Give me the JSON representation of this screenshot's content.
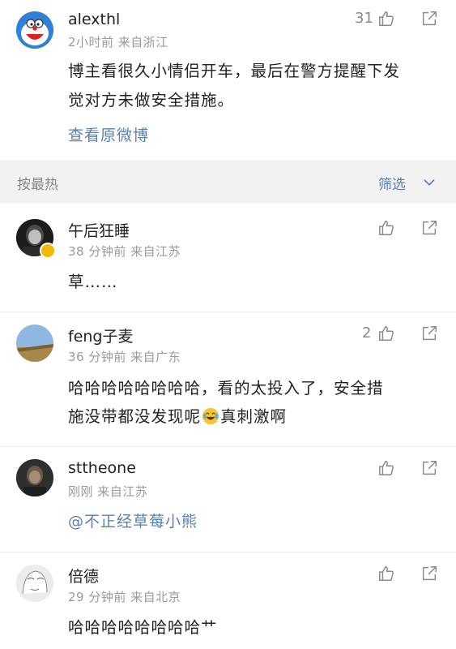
{
  "post": {
    "author": "alexthl",
    "meta": "2小时前   来自浙江",
    "like_count": "31",
    "text_line1": "博主看很久小情侣开车，最后在警方提醒下发",
    "text_line2": "觉对方未做安全措施。",
    "view_original": "查看原微博"
  },
  "sort_bar": {
    "sort_label": "按最热",
    "filter_label": "筛选"
  },
  "comments": [
    {
      "author": "午后狂睡",
      "meta": "38 分钟前   来自江苏",
      "like_count": "",
      "text_line1": "草……",
      "text_line2": ""
    },
    {
      "author": "feng子麦",
      "meta": "36 分钟前   来自广东",
      "like_count": "2",
      "text_line1": "哈哈哈哈哈哈哈哈，看的太投入了，安全措",
      "text_line2": "施没带都没发现呢",
      "text_line2_tail": "真刺激啊"
    },
    {
      "author": "sttheone",
      "meta": "刚刚   来自江苏",
      "like_count": "",
      "mention": "@不正经草莓小熊"
    },
    {
      "author": "倍德",
      "meta": "29 分钟前   来自北京",
      "like_count": "",
      "text_line1": "哈哈哈哈哈哈哈哈艹"
    }
  ],
  "icons": {
    "like": "thumbs-up-icon",
    "share": "share-icon",
    "filter_chevron": "chevron-down-icon",
    "emoji": "crying-laughing-emoji",
    "verified": "verified-badge-icon"
  },
  "colors": {
    "link_blue": "#5b80b2",
    "meta_gray": "#9a9a9a",
    "band_gray": "#f2f2f2",
    "badge_yellow": "#f5b800"
  }
}
